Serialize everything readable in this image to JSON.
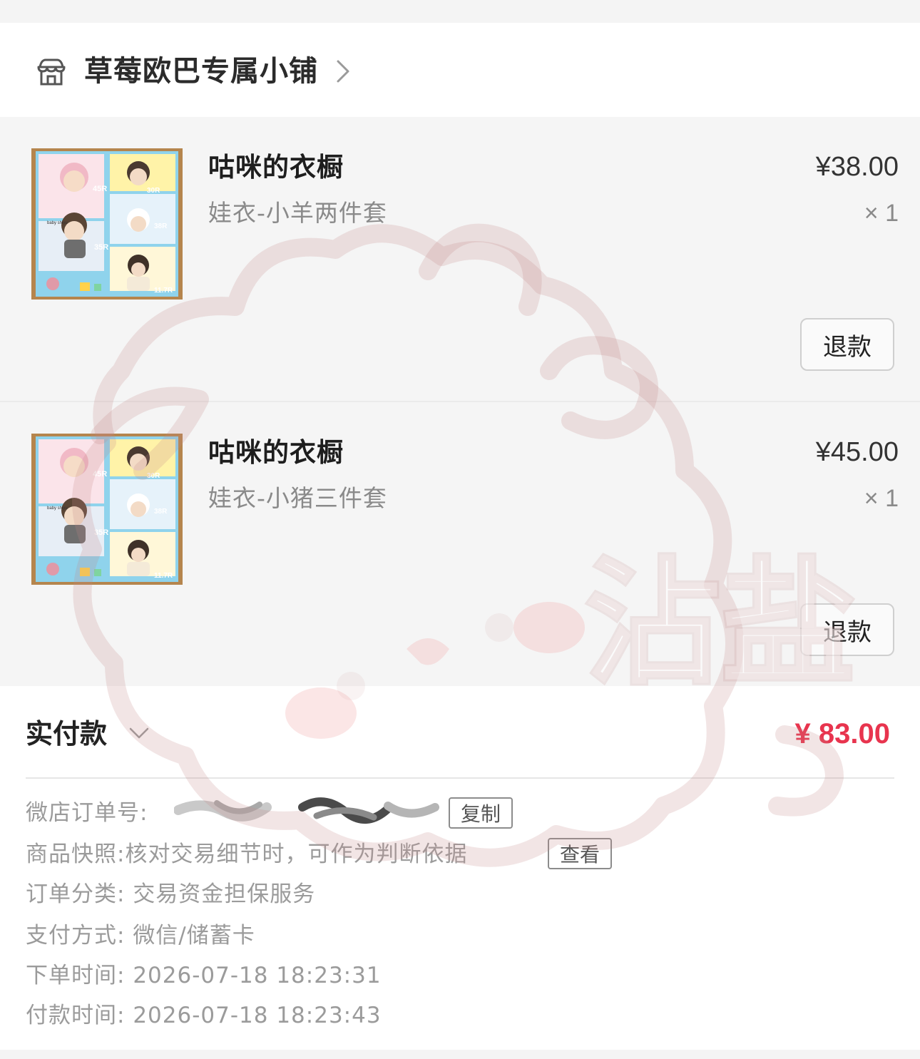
{
  "shop": {
    "name": "草莓欧巴专属小铺",
    "icon": "store-icon"
  },
  "items": [
    {
      "title": "咕咪的衣橱",
      "spec": "娃衣-小羊两件套",
      "price": "¥38.00",
      "qty": "× 1",
      "refund_label": "退款",
      "thumbnail": {
        "labels": [
          "45R",
          "30R",
          "38R",
          "35R",
          "11.7R",
          "baby shiyu"
        ]
      }
    },
    {
      "title": "咕咪的衣橱",
      "spec": "娃衣-小猪三件套",
      "price": "¥45.00",
      "qty": "× 1",
      "refund_label": "退款",
      "thumbnail": {
        "labels": [
          "45R",
          "30R",
          "38R",
          "35R",
          "11.7R",
          "baby shiyu"
        ]
      }
    }
  ],
  "summary": {
    "paid_label": "实付款",
    "paid_amount": "¥ 83.00",
    "accent_color": "#e8344e",
    "order_no_label": "微店订单号:",
    "copy_label": "复制",
    "snapshot_label": "商品快照:",
    "snapshot_text": "核对交易细节时，可作为判断依据",
    "view_label": "查看",
    "category_label": "订单分类:",
    "category_value": "交易资金担保服务",
    "pay_method_label": "支付方式:",
    "pay_method_value": "微信/储蓄卡",
    "order_time_label": "下单时间:",
    "order_time_value": "2026-07-18 18:23:31",
    "pay_time_label": "付款时间:",
    "pay_time_value": "2026-07-18 18:23:43"
  },
  "watermark": {
    "text": "沾盐"
  }
}
